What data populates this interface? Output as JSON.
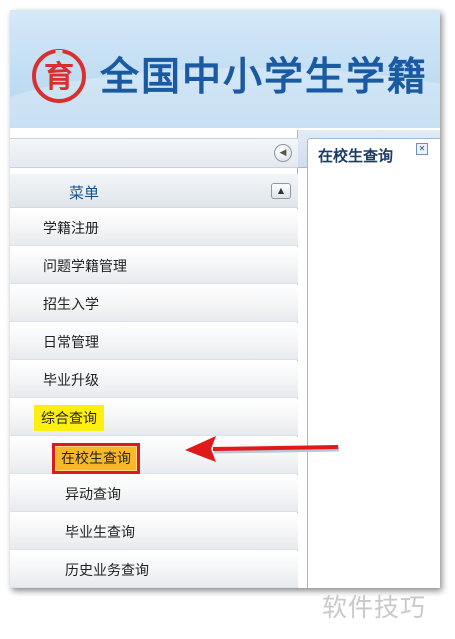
{
  "header": {
    "title": "全国中小学生学籍",
    "logo_glyph": "育",
    "colors": {
      "title": "#1a5aa2",
      "logo": "#d9302f"
    }
  },
  "left_panel": {
    "menu_title": "菜单",
    "collapse_icon": "chevron-left-icon",
    "menu_collapse_icon": "chevron-up-icon",
    "items": [
      {
        "label": "学籍注册"
      },
      {
        "label": "问题学籍管理"
      },
      {
        "label": "招生入学"
      },
      {
        "label": "日常管理"
      },
      {
        "label": "毕业升级"
      },
      {
        "label": "综合查询",
        "highlight": "#ffee11"
      }
    ],
    "sub_items": [
      {
        "label": "在校生查询",
        "selected": true,
        "highlight": "#f7b92a"
      },
      {
        "label": "异动查询"
      },
      {
        "label": "毕业生查询"
      },
      {
        "label": "历史业务查询"
      }
    ]
  },
  "right_panel": {
    "tab_label": "在校生查询",
    "tab_close_icon": "close-icon"
  },
  "annotation": {
    "arrow_color": "#e01a1a"
  },
  "watermark": "软件技巧"
}
